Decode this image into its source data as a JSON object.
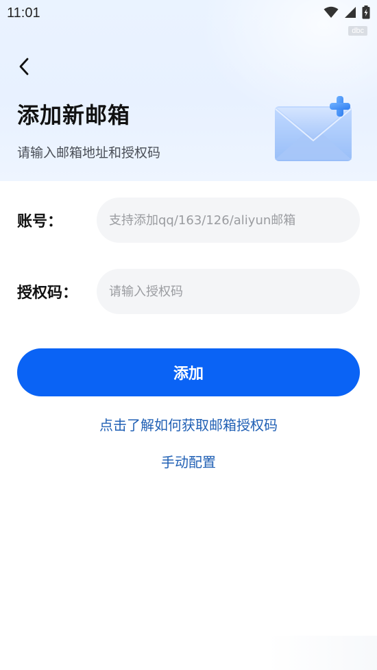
{
  "status_bar": {
    "time": "11:01",
    "chip_label": "dbc",
    "icons": [
      "wifi-icon",
      "signal-icon",
      "battery-charging-icon"
    ]
  },
  "header": {
    "back_icon": "chevron-left-icon",
    "title": "添加新邮箱",
    "subtitle": "请输入邮箱地址和授权码",
    "illustration": "envelope-plus-icon"
  },
  "form": {
    "account": {
      "label": "账号：",
      "value": "",
      "placeholder": "支持添加qq/163/126/aliyun邮箱"
    },
    "auth_code": {
      "label": "授权码：",
      "value": "",
      "placeholder": "请输入授权码"
    }
  },
  "actions": {
    "add_label": "添加",
    "help_link": "点击了解如何获取邮箱授权码",
    "manual_link": "手动配置"
  },
  "colors": {
    "primary": "#0a63f5",
    "link": "#1f5fb4",
    "input_bg": "#f4f5f7",
    "header_bg": "#eaf3ff"
  }
}
